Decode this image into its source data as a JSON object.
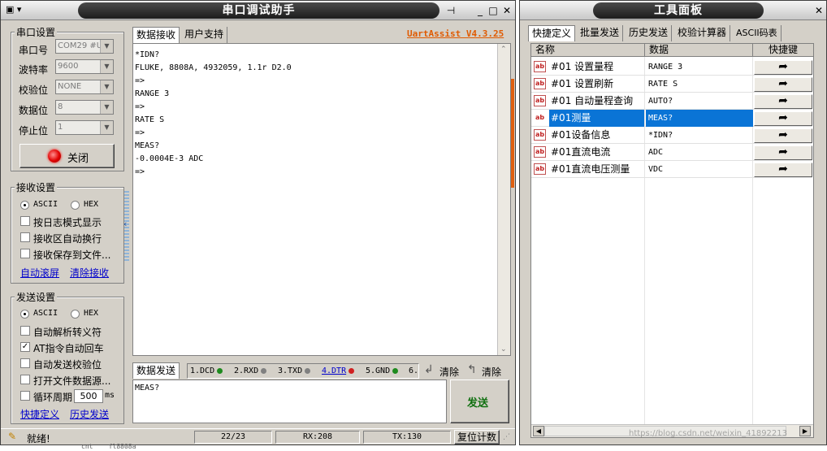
{
  "serial_window": {
    "title": "串口调试助手",
    "version": "UartAssist V4.3.25",
    "settings": {
      "title": "串口设置",
      "port_label": "串口号",
      "port_value": "COM29 #US",
      "baud_label": "波特率",
      "baud_value": "9600",
      "parity_label": "校验位",
      "parity_value": "NONE",
      "databits_label": "数据位",
      "databits_value": "8",
      "stopbits_label": "停止位",
      "stopbits_value": "1",
      "close_label": "关闭"
    },
    "receive_settings": {
      "title": "接收设置",
      "ascii_label": "ASCII",
      "hex_label": "HEX",
      "log_mode_label": "按日志模式显示",
      "auto_wrap_label": "接收区自动换行",
      "save_file_label": "接收保存到文件...",
      "auto_scroll_link": "自动滚屏",
      "clear_link": "清除接收"
    },
    "send_settings": {
      "title": "发送设置",
      "ascii_label": "ASCII",
      "hex_label": "HEX",
      "escape_label": "自动解析转义符",
      "at_cr_label": "AT指令自动回车",
      "checksum_label": "自动发送校验位",
      "open_file_label": "打开文件数据源...",
      "cycle_label": "循环周期",
      "cycle_value": "500",
      "cycle_unit": "ms",
      "shortcut_link": "快捷定义",
      "history_link": "历史发送"
    },
    "tabs": [
      "数据接收",
      "用户支持"
    ],
    "received_lines": [
      "*IDN?",
      "FLUKE, 8808A, 4932059, 1.1r D2.0",
      "=>",
      "RANGE 3",
      "=>",
      "RATE S",
      "=>",
      "MEAS?",
      "-0.0004E-3 ADC",
      "=>"
    ],
    "send_tab": "数据发送",
    "signals": [
      {
        "label": "1.DCD",
        "color": "#1e8a1e"
      },
      {
        "label": "2.RXD",
        "color": "#808080"
      },
      {
        "label": "3.TXD",
        "color": "#808080"
      },
      {
        "label": "4.DTR",
        "color": "#d02020"
      },
      {
        "label": "5.GND",
        "color": "#1e8a1e"
      },
      {
        "label": "6.",
        "color": ""
      }
    ],
    "clear_label_1": "清除",
    "clear_label_2": "清除",
    "send_text": "MEAS?",
    "send_button": "发送",
    "status": {
      "ready": "就绪!",
      "count": "22/23",
      "rx": "RX:208",
      "tx": "TX:130",
      "reset": "复位计数"
    }
  },
  "tool_window": {
    "title": "工具面板",
    "tabs": [
      "快捷定义",
      "批量发送",
      "历史发送",
      "校验计算器",
      "ASCII码表"
    ],
    "columns": {
      "name": "名称",
      "data": "数据",
      "send": "快捷键"
    },
    "rows": [
      {
        "name": "#01 设置量程",
        "data": "RANGE 3",
        "selected": false
      },
      {
        "name": "#01 设置刷新",
        "data": "RATE S",
        "selected": false
      },
      {
        "name": "#01 自动量程查询",
        "data": "AUTO?",
        "selected": false
      },
      {
        "name": "#01测量",
        "data": "MEAS?",
        "selected": true
      },
      {
        "name": "#01设备信息",
        "data": "*IDN?",
        "selected": false
      },
      {
        "name": "#01直流电流",
        "data": "ADC",
        "selected": false
      },
      {
        "name": "#01直流电压测量",
        "data": "VDC",
        "selected": false
      }
    ],
    "watermark": "https://blog.csdn.net/weixin_41892213"
  },
  "background_text": "cnt    fl8808a"
}
